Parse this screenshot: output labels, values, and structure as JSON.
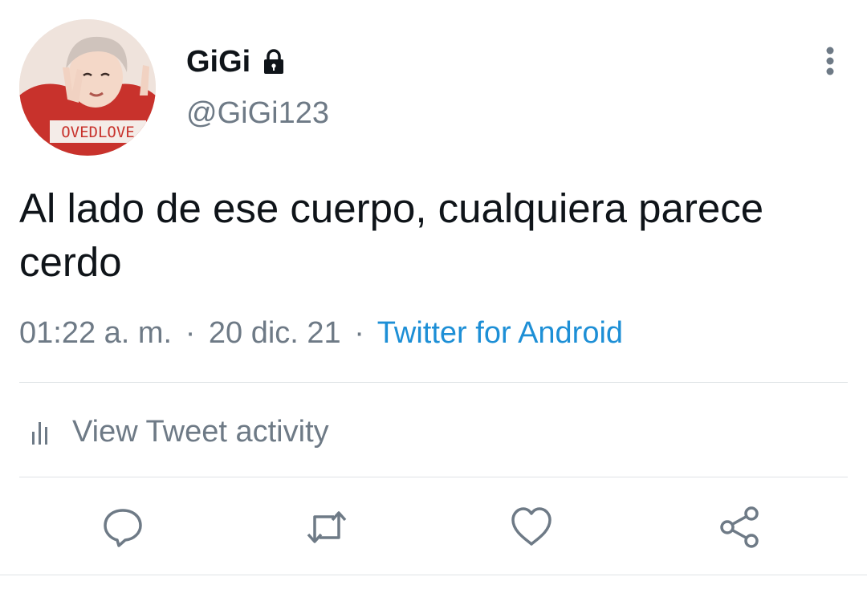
{
  "user": {
    "display_name": "GiGi",
    "handle": "@GiGi123",
    "avatar_text": "OVEDLOVE"
  },
  "tweet": {
    "text": "Al lado de ese cuerpo, cualquiera parece cerdo",
    "time": "01:22 a. m.",
    "date": "20 dic. 21",
    "separator": "·",
    "source": "Twitter for Android"
  },
  "activity": {
    "label": "View Tweet activity"
  },
  "icons": {
    "lock": "lock-icon",
    "more": "more-vertical-icon",
    "activity": "bar-chart-icon",
    "reply": "comment-icon",
    "retweet": "retweet-icon",
    "like": "heart-icon",
    "share": "share-icon"
  },
  "colors": {
    "text": "#0f1419",
    "secondary": "#6e7a86",
    "link": "#1d8fd6",
    "divider": "#dfe3e6"
  }
}
